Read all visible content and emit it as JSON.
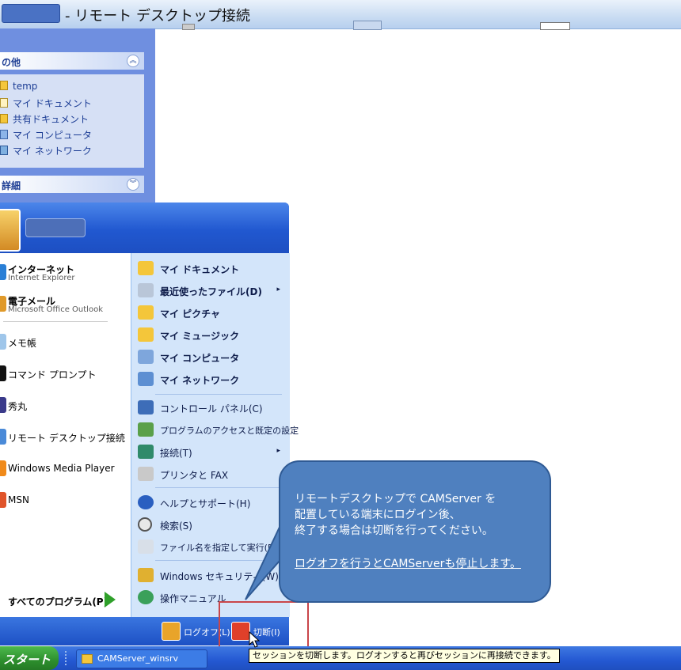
{
  "window": {
    "title": "- リモート デスクトップ接続"
  },
  "explorer": {
    "other_section": {
      "title": "の他",
      "links": [
        "temp",
        "マイ ドキュメント",
        "共有ドキュメント",
        "マイ コンピュータ",
        "マイ ネットワーク"
      ]
    },
    "details_section": {
      "title": "詳細"
    }
  },
  "start_menu": {
    "pinned": [
      {
        "title": "インターネット",
        "subtitle": "Internet Explorer"
      },
      {
        "title": "電子メール",
        "subtitle": "Microsoft Office Outlook"
      }
    ],
    "recent": [
      "メモ帳",
      "コマンド プロンプト",
      "秀丸",
      "リモート デスクトップ接続",
      "Windows Media Player",
      "MSN"
    ],
    "all_programs": "すべてのプログラム(P)",
    "right": [
      {
        "label": "マイ ドキュメント",
        "bold": true
      },
      {
        "label": "最近使ったファイル(D)",
        "bold": true,
        "submenu": true
      },
      {
        "label": "マイ ピクチャ",
        "bold": true
      },
      {
        "label": "マイ ミュージック",
        "bold": true
      },
      {
        "label": "マイ コンピュータ",
        "bold": true
      },
      {
        "label": "マイ ネットワーク",
        "bold": true
      },
      {
        "label": "コントロール パネル(C)"
      },
      {
        "label": "プログラムのアクセスと既定の設定"
      },
      {
        "label": "接続(T)",
        "submenu": true
      },
      {
        "label": "プリンタと FAX"
      },
      {
        "label": "ヘルプとサポート(H)"
      },
      {
        "label": "検索(S)"
      },
      {
        "label": "ファイル名を指定して実行(R)..."
      },
      {
        "label": "Windows セキュリティ(W)"
      },
      {
        "label": "操作マニュアル"
      }
    ],
    "submenu_arrow": "▸",
    "logoff": "ログオフ(L)",
    "disconnect": "切断(I)"
  },
  "tooltip": "セッションを切断します。ログオンすると再びセッションに再接続できます。",
  "callout": {
    "lines": [
      "リモートデスクトップで CAMServer を",
      "配置している端末にログイン後、",
      "終了する場合は切断を行ってください。"
    ],
    "underline": "ログオフを行うとCAMServerも停止します。"
  },
  "taskbar": {
    "start": "スタート",
    "item": "CAMServer_winsrv"
  },
  "icons": {
    "chevron_up": "︽",
    "chevron_down": "︾"
  }
}
